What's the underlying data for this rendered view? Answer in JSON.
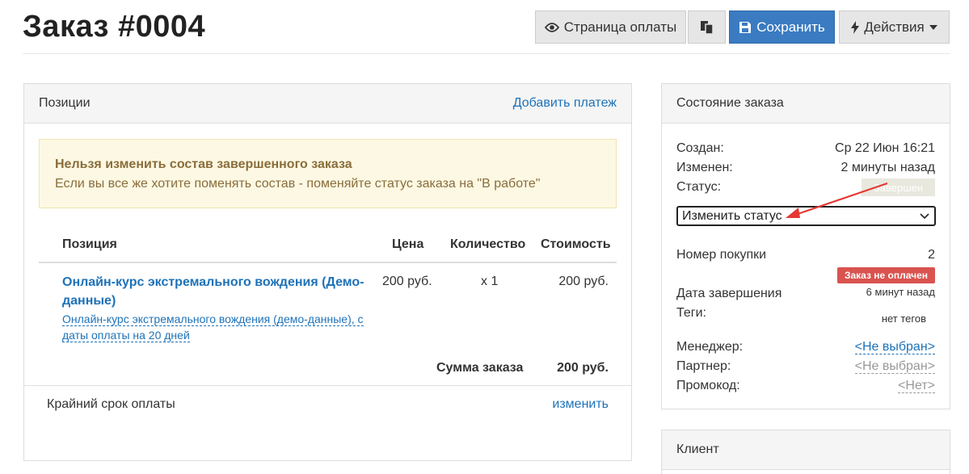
{
  "header": {
    "title": "Заказ #0004",
    "pay_page_label": "Страница оплаты",
    "save_label": "Сохранить",
    "actions_label": "Действия"
  },
  "items_panel": {
    "title": "Позиции",
    "add_payment": "Добавить платеж",
    "alert": {
      "title": "Нельзя изменить состав завершенного заказа",
      "text": "Если вы все же хотите поменять состав - поменяйте статус заказа на \"В работе\""
    },
    "columns": [
      "Позиция",
      "Цена",
      "Количество",
      "Стоимость"
    ],
    "rows": [
      {
        "name": "Онлайн-курс экстремального вождения (Демо-данные)",
        "description": "Онлайн-курс экстремального вождения (демо-данные), с даты оплаты на 20 дней",
        "price": "200 руб.",
        "quantity": "x 1",
        "cost": "200 руб."
      }
    ],
    "sum_label": "Сумма заказа",
    "sum_value": "200 руб.",
    "deadline_label": "Крайний срок оплаты",
    "deadline_link": "изменить"
  },
  "status_panel": {
    "title": "Состояние заказа",
    "created_label": "Создан:",
    "created_value": "Ср 22 Июн 16:21",
    "changed_label": "Изменен:",
    "changed_value": "2 минуты назад",
    "status_label": "Статус:",
    "status_value": "Завершен",
    "change_status_select": "Изменить статус",
    "purchase_number_label": "Номер покупки",
    "purchase_number_value": "2",
    "unpaid_badge": "Заказ не оплачен",
    "completion_label": "Дата завершения",
    "completion_value": "6 минут назад",
    "tags_label": "Теги:",
    "tags_value": "нет тегов",
    "manager_label": "Менеджер:",
    "manager_value": "<Не выбран>",
    "partner_label": "Партнер:",
    "partner_value": "<Не выбран>",
    "promo_label": "Промокод:",
    "promo_value": "<Нет>"
  },
  "client_panel": {
    "title": "Клиент"
  },
  "colors": {
    "primary": "#3a7bc2",
    "link": "#1e72b8",
    "danger": "#d9534f",
    "warning_bg": "#fcf8e3",
    "annotation_arrow": "#e53935"
  }
}
